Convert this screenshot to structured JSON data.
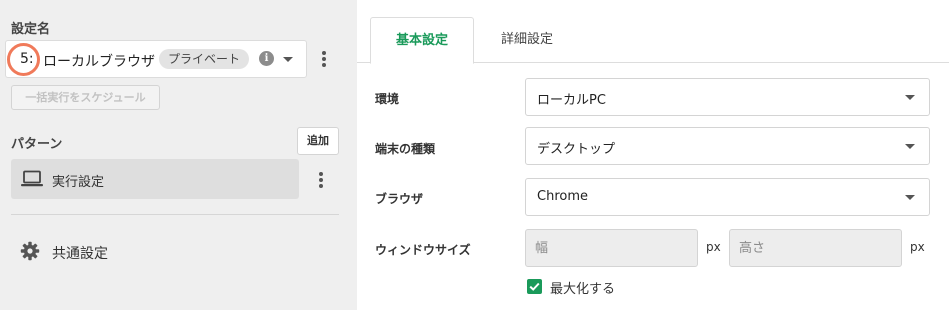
{
  "sidebar": {
    "setting_label": "設定名",
    "selected_setting": {
      "number": "5:",
      "name": "ローカルブラウザ",
      "badge": "プライベート"
    },
    "schedule_button": "一括実行をスケジュール",
    "pattern_label": "パターン",
    "add_button": "追加",
    "patterns": [
      {
        "label": "実行設定"
      }
    ],
    "common_settings": "共通設定"
  },
  "tabs": [
    {
      "label": "基本設定",
      "active": true
    },
    {
      "label": "詳細設定",
      "active": false
    }
  ],
  "form": {
    "environment": {
      "label": "環境",
      "value": "ローカルPC"
    },
    "device_type": {
      "label": "端末の種類",
      "value": "デスクトップ"
    },
    "browser": {
      "label": "ブラウザ",
      "value": "Chrome"
    },
    "window_size": {
      "label": "ウィンドウサイズ",
      "width_placeholder": "幅",
      "height_placeholder": "高さ",
      "unit": "px"
    },
    "maximize": {
      "label": "最大化する",
      "checked": true
    }
  },
  "colors": {
    "accent": "#1a9a5a",
    "highlight_ring": "#f07a5a",
    "sidebar_bg": "#efefef"
  },
  "icons": [
    "info-icon",
    "chevron-down-icon",
    "more-vert-icon",
    "laptop-icon",
    "gear-icon",
    "check-icon"
  ]
}
